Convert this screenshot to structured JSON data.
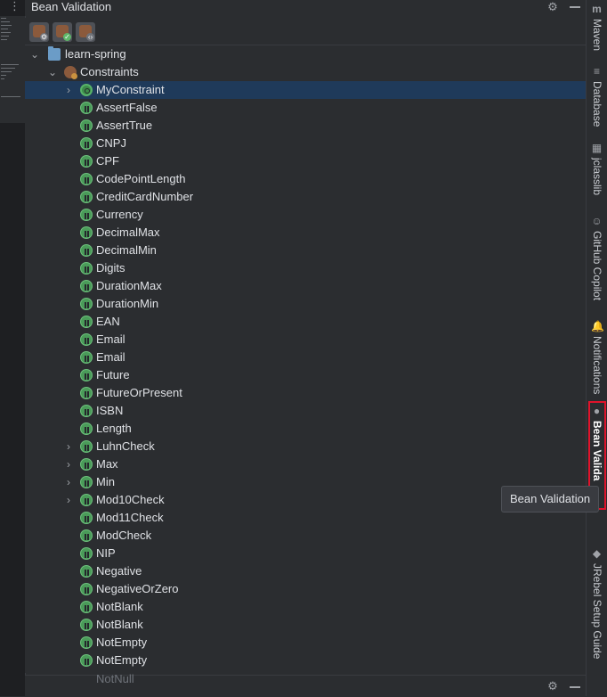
{
  "window": {
    "title": "Bean Validation"
  },
  "toolbar": {
    "buttons": [
      {
        "name": "settings-constraint",
        "badge_color": "#a0a3a8"
      },
      {
        "name": "validate-constraint",
        "badge_color": "#5fb86a"
      },
      {
        "name": "code-constraint",
        "badge_color": "#a0a3a8"
      }
    ]
  },
  "tree": {
    "project": "learn-spring",
    "package": "Constraints",
    "selected": "MyConstraint",
    "items": [
      {
        "label": "MyConstraint",
        "expandable": true,
        "custom": true
      },
      {
        "label": "AssertFalse",
        "expandable": false
      },
      {
        "label": "AssertTrue",
        "expandable": false
      },
      {
        "label": "CNPJ",
        "expandable": false
      },
      {
        "label": "CPF",
        "expandable": false
      },
      {
        "label": "CodePointLength",
        "expandable": false
      },
      {
        "label": "CreditCardNumber",
        "expandable": false
      },
      {
        "label": "Currency",
        "expandable": false
      },
      {
        "label": "DecimalMax",
        "expandable": false
      },
      {
        "label": "DecimalMin",
        "expandable": false
      },
      {
        "label": "Digits",
        "expandable": false
      },
      {
        "label": "DurationMax",
        "expandable": false
      },
      {
        "label": "DurationMin",
        "expandable": false
      },
      {
        "label": "EAN",
        "expandable": false
      },
      {
        "label": "Email",
        "expandable": false
      },
      {
        "label": "Email",
        "expandable": false
      },
      {
        "label": "Future",
        "expandable": false
      },
      {
        "label": "FutureOrPresent",
        "expandable": false
      },
      {
        "label": "ISBN",
        "expandable": false
      },
      {
        "label": "Length",
        "expandable": false
      },
      {
        "label": "LuhnCheck",
        "expandable": true
      },
      {
        "label": "Max",
        "expandable": true
      },
      {
        "label": "Min",
        "expandable": true
      },
      {
        "label": "Mod10Check",
        "expandable": true
      },
      {
        "label": "Mod11Check",
        "expandable": false
      },
      {
        "label": "ModCheck",
        "expandable": false
      },
      {
        "label": "NIP",
        "expandable": false
      },
      {
        "label": "Negative",
        "expandable": false
      },
      {
        "label": "NegativeOrZero",
        "expandable": false
      },
      {
        "label": "NotBlank",
        "expandable": false
      },
      {
        "label": "NotBlank",
        "expandable": false
      },
      {
        "label": "NotEmpty",
        "expandable": false
      },
      {
        "label": "NotEmpty",
        "expandable": false
      }
    ],
    "partial_next": "NotNull"
  },
  "right_stripe": [
    {
      "label": "Maven",
      "icon": "maven-icon",
      "glyph": "m",
      "active": false
    },
    {
      "label": "Database",
      "icon": "database-icon",
      "glyph": "≡",
      "active": false
    },
    {
      "label": "jclasslib",
      "icon": "jclasslib-icon",
      "glyph": "▦",
      "active": false
    },
    {
      "label": "GitHub Copilot",
      "icon": "copilot-icon",
      "glyph": "☺",
      "active": false
    },
    {
      "label": "Notifications",
      "icon": "bell-icon",
      "glyph": "🔔",
      "active": false
    },
    {
      "label": "Bean Valida",
      "icon": "bean-validation-icon",
      "glyph": "●",
      "active": true
    },
    {
      "label": "JRebel Setup Guide",
      "icon": "jrebel-icon",
      "glyph": "◆",
      "active": false
    }
  ],
  "tooltip": {
    "text": "Bean Validation"
  },
  "colors": {
    "selection": "#1f3a5a",
    "highlight": "#e0132b",
    "constraint_icon": "#4a9b59"
  }
}
